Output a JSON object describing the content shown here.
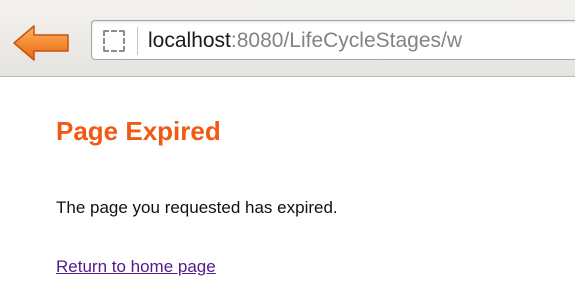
{
  "browser": {
    "url_host": "localhost",
    "url_rest": ":8080/LifeCycleStages/w",
    "back_icon": "back-arrow-icon",
    "site_icon": "page-icon",
    "colors": {
      "back_arrow": "#f07a20"
    }
  },
  "page": {
    "title": "Page Expired",
    "message": "The page you requested has expired.",
    "home_link": "Return to home page",
    "colors": {
      "title": "#f05a15",
      "link": "#551a8b"
    }
  }
}
